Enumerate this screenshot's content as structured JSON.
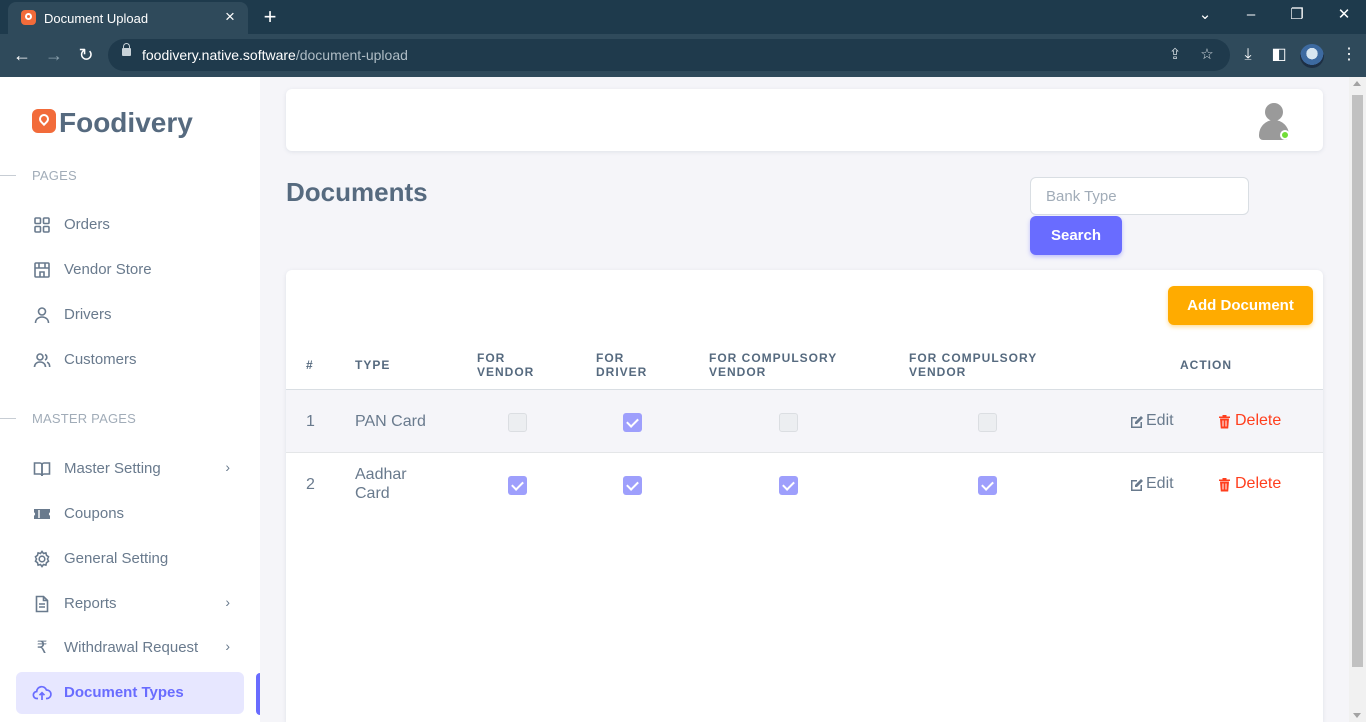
{
  "browser": {
    "tab_title": "Document Upload",
    "url_host": "foodivery.native.software",
    "url_path": "/document-upload"
  },
  "sidebar": {
    "brand": "Foodivery",
    "section_pages": "PAGES",
    "section_master": "MASTER PAGES",
    "items": [
      {
        "label": "Orders",
        "icon": "grid-icon"
      },
      {
        "label": "Vendor Store",
        "icon": "store-icon"
      },
      {
        "label": "Drivers",
        "icon": "user-icon"
      },
      {
        "label": "Customers",
        "icon": "users-icon"
      },
      {
        "label": "Master Setting",
        "icon": "book-icon",
        "has_submenu": true
      },
      {
        "label": "Coupons",
        "icon": "ticket-icon"
      },
      {
        "label": "General Setting",
        "icon": "gear-icon"
      },
      {
        "label": "Reports",
        "icon": "file-icon",
        "has_submenu": true
      },
      {
        "label": "Withdrawal Request",
        "icon": "rupee-icon",
        "has_submenu": true
      },
      {
        "label": "Document Types",
        "icon": "cloud-upload-icon",
        "active": true
      }
    ]
  },
  "main": {
    "title": "Documents",
    "search_placeholder": "Bank Type",
    "search_button": "Search",
    "add_button": "Add Document"
  },
  "table": {
    "headers": {
      "num": "#",
      "type": "TYPE",
      "vendor": "FOR\nVENDOR",
      "driver": "FOR\nDRIVER",
      "comp_vendor_1": "FOR COMPULSORY\nVENDOR",
      "comp_vendor_2": "FOR COMPULSORY\nVENDOR",
      "action": "ACTION"
    },
    "rows": [
      {
        "num": "1",
        "type": "PAN Card",
        "for_vendor": false,
        "for_driver": true,
        "for_compulsory_vendor_1": false,
        "for_compulsory_vendor_2": false,
        "edit": "Edit",
        "delete": "Delete"
      },
      {
        "num": "2",
        "type": "Aadhar\nCard",
        "for_vendor": true,
        "for_driver": true,
        "for_compulsory_vendor_1": true,
        "for_compulsory_vendor_2": true,
        "edit": "Edit",
        "delete": "Delete"
      }
    ]
  },
  "colors": {
    "primary": "#696cff",
    "warning": "#ffab00",
    "danger": "#ff3e1d",
    "brand": "#f26b3a"
  }
}
